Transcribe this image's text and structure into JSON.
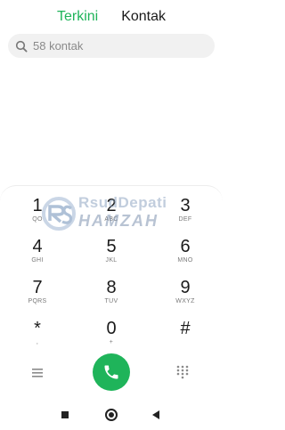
{
  "tabs": [
    {
      "label": "Terkini",
      "active": true
    },
    {
      "label": "Kontak",
      "active": false
    }
  ],
  "search": {
    "placeholder": "58 kontak",
    "icon": "search-icon"
  },
  "watermark": {
    "logo": "RS",
    "line1": "RsudDepati",
    "line2": "HAMZAH"
  },
  "keypad": [
    {
      "digit": "1",
      "letters": "QO"
    },
    {
      "digit": "2",
      "letters": "ABC"
    },
    {
      "digit": "3",
      "letters": "DEF"
    },
    {
      "digit": "4",
      "letters": "GHI"
    },
    {
      "digit": "5",
      "letters": "JKL"
    },
    {
      "digit": "6",
      "letters": "MNO"
    },
    {
      "digit": "7",
      "letters": "PQRS"
    },
    {
      "digit": "8",
      "letters": "TUV"
    },
    {
      "digit": "9",
      "letters": "WXYZ"
    },
    {
      "digit": "*",
      "letters": ","
    },
    {
      "digit": "0",
      "letters": "+"
    },
    {
      "digit": "#",
      "letters": ""
    }
  ],
  "actions": {
    "menu_icon": "menu-icon",
    "call_icon": "phone-icon",
    "keypad_icon": "keypad-icon"
  },
  "colors": {
    "accent": "#1fb45a",
    "search_bg": "#f1f1f1"
  },
  "navbar": {
    "recents_icon": "square-icon",
    "home_icon": "home-circle-icon",
    "back_icon": "back-triangle-icon"
  }
}
